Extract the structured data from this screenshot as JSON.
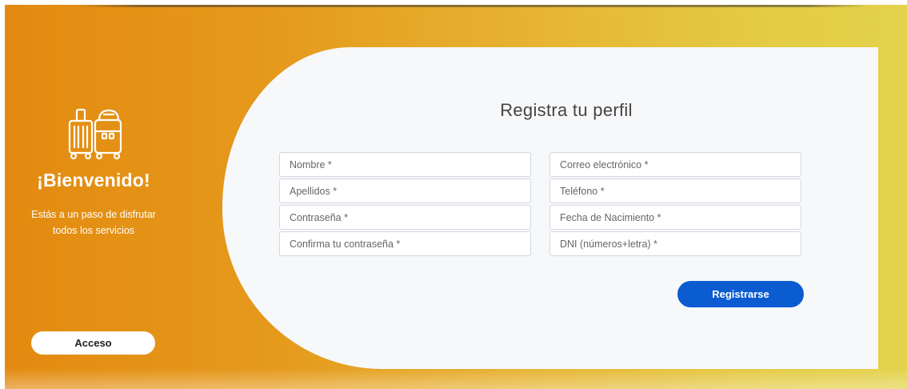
{
  "colors": {
    "gradient_start": "#e38a10",
    "gradient_end": "#e3d24c",
    "card_background": "#f7f8fa",
    "primary_button": "#0b5bd1"
  },
  "welcome_panel": {
    "icon": "luggage-icon",
    "heading": "¡Bienvenido!",
    "message_line1": "Estás a un paso de disfrutar",
    "message_line2": "todos los servicios",
    "login_button": "Acceso"
  },
  "register_form": {
    "title": "Registra tu perfil",
    "fields": {
      "nombre": "Nombre *",
      "apellidos": "Apellidos *",
      "contrasena": "Contraseña *",
      "confirma_contrasena": "Confirma tu contraseña *",
      "correo": "Correo electrónico *",
      "telefono": "Teléfono *",
      "fecha_nacimiento": "Fecha de Nacimiento *",
      "dni": "DNI (números+letra) *"
    },
    "submit_button": "Registrarse"
  }
}
